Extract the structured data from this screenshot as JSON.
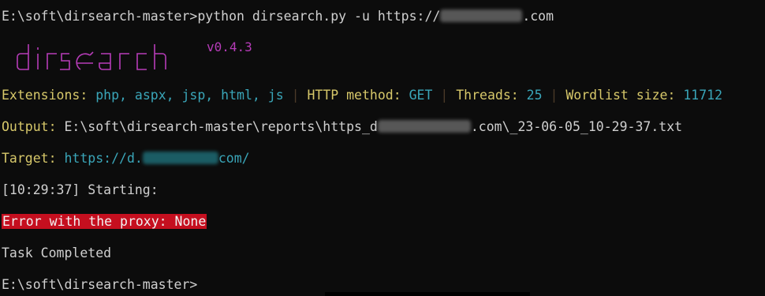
{
  "command": {
    "prompt": "E:\\soft\\dirsearch-master>",
    "cmd_prefix": "python dirsearch.py -u https://",
    "cmd_suffix": ".com"
  },
  "banner": {
    "logo_text": "dirsearch",
    "version": "v0.4.3",
    "logo_color": "#b63cb8"
  },
  "config": {
    "extensions_label": "Extensions:",
    "extensions_value": "php, aspx, jsp, html, js",
    "separator": "|",
    "method_label": "HTTP method:",
    "method_value": "GET",
    "threads_label": "Threads:",
    "threads_value": "25",
    "wordlist_label": "Wordlist size:",
    "wordlist_value": "11712"
  },
  "output": {
    "label": "Output:",
    "path_prefix": "E:\\soft\\dirsearch-master\\reports\\https_d",
    "path_suffix": ".com\\_23-06-05_10-29-37.txt"
  },
  "target": {
    "label": "Target:",
    "url_prefix": "https://d.",
    "url_suffix": "com/"
  },
  "status": {
    "starting": "[10:29:37] Starting:",
    "error": "Error with the proxy: None",
    "completed": "Task Completed"
  },
  "final_prompt": "E:\\soft\\dirsearch-master>",
  "colors": {
    "background": "#0c0c0c",
    "text": "#cccccc",
    "label_yellow": "#d7c86a",
    "value_cyan": "#3aa6b9",
    "error_bg": "#c50f1f"
  }
}
